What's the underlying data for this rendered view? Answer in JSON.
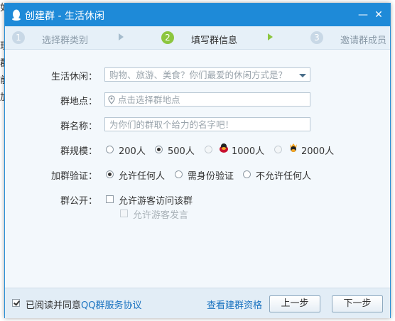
{
  "background_fragments": [
    "如",
    "现",
    "群",
    "前",
    "加"
  ],
  "window": {
    "title": "创建群 - 生活休闲",
    "minimize_glyph": "—",
    "close_glyph": "✕"
  },
  "steps": [
    {
      "num": "1",
      "label": "选择群类别"
    },
    {
      "num": "2",
      "label": "填写群信息"
    },
    {
      "num": "3",
      "label": "邀请群成员"
    }
  ],
  "form": {
    "category_label": "生活休闲：",
    "category_placeholder": "购物、旅游、美食？你们最爱的休闲方式是？",
    "location_label": "群地点：",
    "location_placeholder": "点击选择群地点",
    "name_label": "群名称：",
    "name_placeholder": "为你们的群取个给力的名字吧！",
    "size_label": "群规模：",
    "size_options": [
      "200人",
      "500人",
      "1000人",
      "2000人"
    ],
    "size_selected": "500人",
    "verify_label": "加群验证：",
    "verify_options": [
      "允许任何人",
      "需身份验证",
      "不允许任何人"
    ],
    "verify_selected": "允许任何人",
    "public_label": "群公开：",
    "public_visitor_view": "允许游客访问该群",
    "public_visitor_post": "允许游客发言"
  },
  "footer": {
    "agree_prefix": "已阅读并同意",
    "agree_link": "QQ群服务协议",
    "qualification_link": "查看建群资格",
    "prev_button": "上一步",
    "next_button": "下一步"
  },
  "colors": {
    "titlebar": "#1e8ad8",
    "active_step": "#8cc63f",
    "link": "#1a73c0"
  }
}
